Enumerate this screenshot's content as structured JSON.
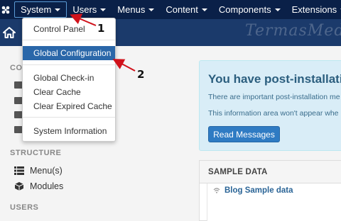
{
  "topnav": {
    "items": [
      {
        "label": "System"
      },
      {
        "label": "Users"
      },
      {
        "label": "Menus"
      },
      {
        "label": "Content"
      },
      {
        "label": "Components"
      },
      {
        "label": "Extensions"
      }
    ]
  },
  "watermark": "TermasMedia",
  "dropdown": {
    "items": [
      "Control Panel",
      "Global Configuration",
      "Global Check-in",
      "Clear Cache",
      "Clear Expired Cache",
      "System Information"
    ]
  },
  "sidebar": {
    "partial_heading": "CO",
    "structure_heading": "STRUCTURE",
    "menus_label": "Menu(s)",
    "modules_label": "Modules",
    "users_heading": "USERS"
  },
  "postinstall": {
    "title": "You have post-installation",
    "line1": "There are important post-installation me",
    "line2": "This information area won't appear whe",
    "button": "Read Messages"
  },
  "sample": {
    "title": "SAMPLE DATA",
    "blog_link": "Blog Sample data"
  },
  "annotations": {
    "one": "1",
    "two": "2",
    "color": "#d0121b"
  },
  "colors": {
    "nav_bg": "#0a2048",
    "subheader_bg": "#1b3a6b",
    "highlight": "#2a67a9",
    "button": "#2f7bc3"
  }
}
